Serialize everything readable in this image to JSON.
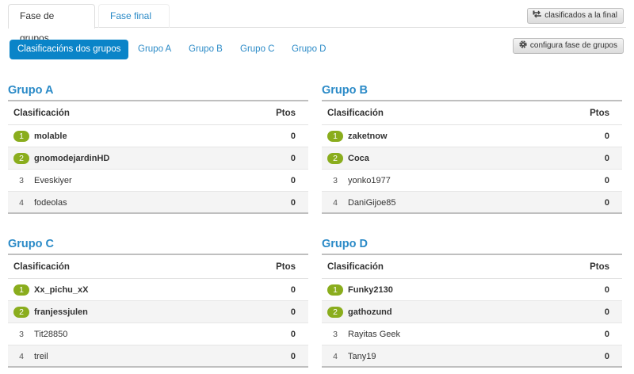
{
  "tabs": [
    {
      "label": "Fase de grupos",
      "active": true
    },
    {
      "label": "Fase final",
      "active": false
    }
  ],
  "buttons": {
    "final_label": "clasificados a la final",
    "final_icon": "swap-arrows-icon",
    "config_label": "configura fase de grupos",
    "config_icon": "gear-icon"
  },
  "pills": [
    {
      "label": "Clasificacións dos grupos",
      "active": true
    },
    {
      "label": "Grupo A",
      "active": false
    },
    {
      "label": "Grupo B",
      "active": false
    },
    {
      "label": "Grupo C",
      "active": false
    },
    {
      "label": "Grupo D",
      "active": false
    }
  ],
  "colors": {
    "accent": "#0a84c8",
    "link": "#2a8ac7",
    "qualified_badge": "#8aad1d"
  },
  "groups": [
    {
      "title": "Grupo A",
      "col_name": "Clasificación",
      "col_pts": "Ptos",
      "rows": [
        {
          "rank": "1",
          "name": "molable",
          "pts": "0",
          "qualified": true
        },
        {
          "rank": "2",
          "name": "gnomodejardinHD",
          "pts": "0",
          "qualified": true
        },
        {
          "rank": "3",
          "name": "Eveskiyer",
          "pts": "0",
          "qualified": false
        },
        {
          "rank": "4",
          "name": "fodeolas",
          "pts": "0",
          "qualified": false
        }
      ]
    },
    {
      "title": "Grupo B",
      "col_name": "Clasificación",
      "col_pts": "Ptos",
      "rows": [
        {
          "rank": "1",
          "name": "zaketnow",
          "pts": "0",
          "qualified": true
        },
        {
          "rank": "2",
          "name": "Coca",
          "pts": "0",
          "qualified": true
        },
        {
          "rank": "3",
          "name": "yonko1977",
          "pts": "0",
          "qualified": false
        },
        {
          "rank": "4",
          "name": "DaniGijoe85",
          "pts": "0",
          "qualified": false
        }
      ]
    },
    {
      "title": "Grupo C",
      "col_name": "Clasificación",
      "col_pts": "Ptos",
      "rows": [
        {
          "rank": "1",
          "name": "Xx_pichu_xX",
          "pts": "0",
          "qualified": true
        },
        {
          "rank": "2",
          "name": "franjessjulen",
          "pts": "0",
          "qualified": true
        },
        {
          "rank": "3",
          "name": "Tit28850",
          "pts": "0",
          "qualified": false
        },
        {
          "rank": "4",
          "name": "treil",
          "pts": "0",
          "qualified": false
        }
      ]
    },
    {
      "title": "Grupo D",
      "col_name": "Clasificación",
      "col_pts": "Ptos",
      "rows": [
        {
          "rank": "1",
          "name": "Funky2130",
          "pts": "0",
          "qualified": true
        },
        {
          "rank": "2",
          "name": "gathozund",
          "pts": "0",
          "qualified": true
        },
        {
          "rank": "3",
          "name": "Rayitas Geek",
          "pts": "0",
          "qualified": false
        },
        {
          "rank": "4",
          "name": "Tany19",
          "pts": "0",
          "qualified": false
        }
      ]
    }
  ]
}
